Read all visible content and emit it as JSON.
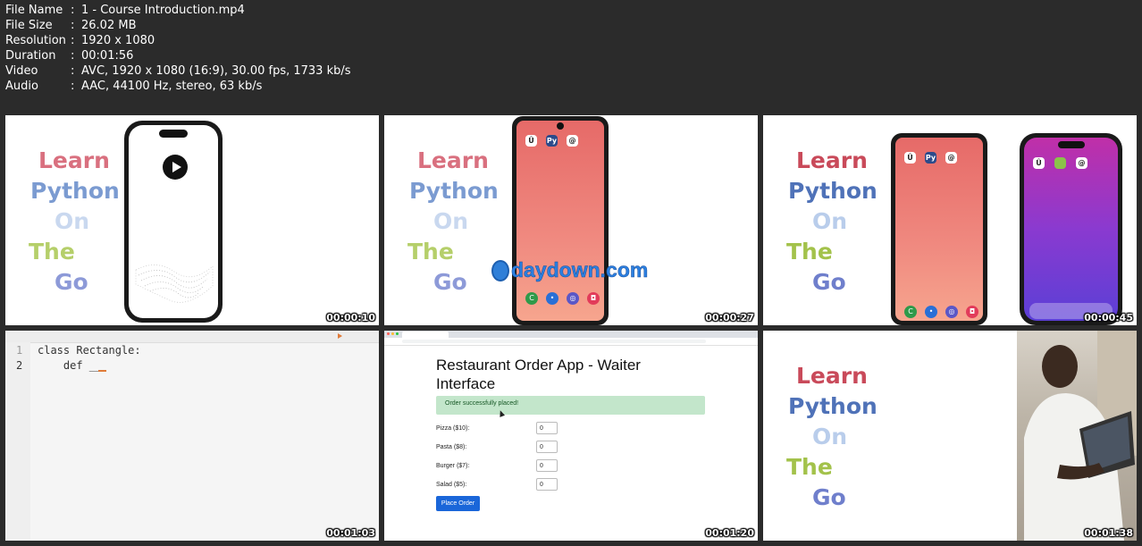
{
  "info": {
    "rows": [
      {
        "key": "File Name",
        "sep": ":",
        "value": "1 - Course Introduction.mp4"
      },
      {
        "key": "File Size",
        "sep": ":",
        "value": "26.02 MB"
      },
      {
        "key": "Resolution",
        "sep": ":",
        "value": "1920 x 1080"
      },
      {
        "key": "Duration",
        "sep": ":",
        "value": "00:01:56"
      },
      {
        "key": "Video",
        "sep": ":",
        "value": "AVC, 1920 x 1080 (16:9), 30.00 fps, 1733 kb/s"
      },
      {
        "key": "Audio",
        "sep": ":",
        "value": "AAC, 44100 Hz, stereo, 63 kb/s"
      }
    ]
  },
  "promo_words": [
    "Learn",
    "Python",
    "On",
    "The",
    "Go"
  ],
  "thumbs": [
    {
      "timestamp": "00:00:10"
    },
    {
      "timestamp": "00:00:27",
      "watermark": "daydown.com"
    },
    {
      "timestamp": "00:00:45"
    },
    {
      "timestamp": "00:01:03",
      "code_lines": [
        {
          "num": "1",
          "text": "class Rectangle:"
        },
        {
          "num": "2",
          "text": "    def __"
        }
      ]
    },
    {
      "timestamp": "00:01:20",
      "app": {
        "title": "Restaurant Order App - Waiter Interface",
        "alert": "Order successfully placed!",
        "items": [
          {
            "label": "Pizza ($10):",
            "value": "0"
          },
          {
            "label": "Pasta ($8):",
            "value": "0"
          },
          {
            "label": "Burger ($7):",
            "value": "0"
          },
          {
            "label": "Salad ($5):",
            "value": "0"
          }
        ],
        "button": "Place Order"
      }
    },
    {
      "timestamp": "00:01:38"
    }
  ],
  "colors": {
    "background": "#2b2b2b",
    "learn": "#d9707f",
    "python": "#7b9bd1",
    "on": "#c9d8ef",
    "the": "#b5cf6a",
    "go": "#8d9ad8",
    "alert_bg": "#c3e6cb",
    "button": "#1a66d9"
  },
  "icons": [
    "play-icon",
    "udemy-icon",
    "pydroid-icon",
    "threads-icon",
    "phone-icon",
    "messages-icon",
    "browser-icon",
    "camera-icon"
  ]
}
